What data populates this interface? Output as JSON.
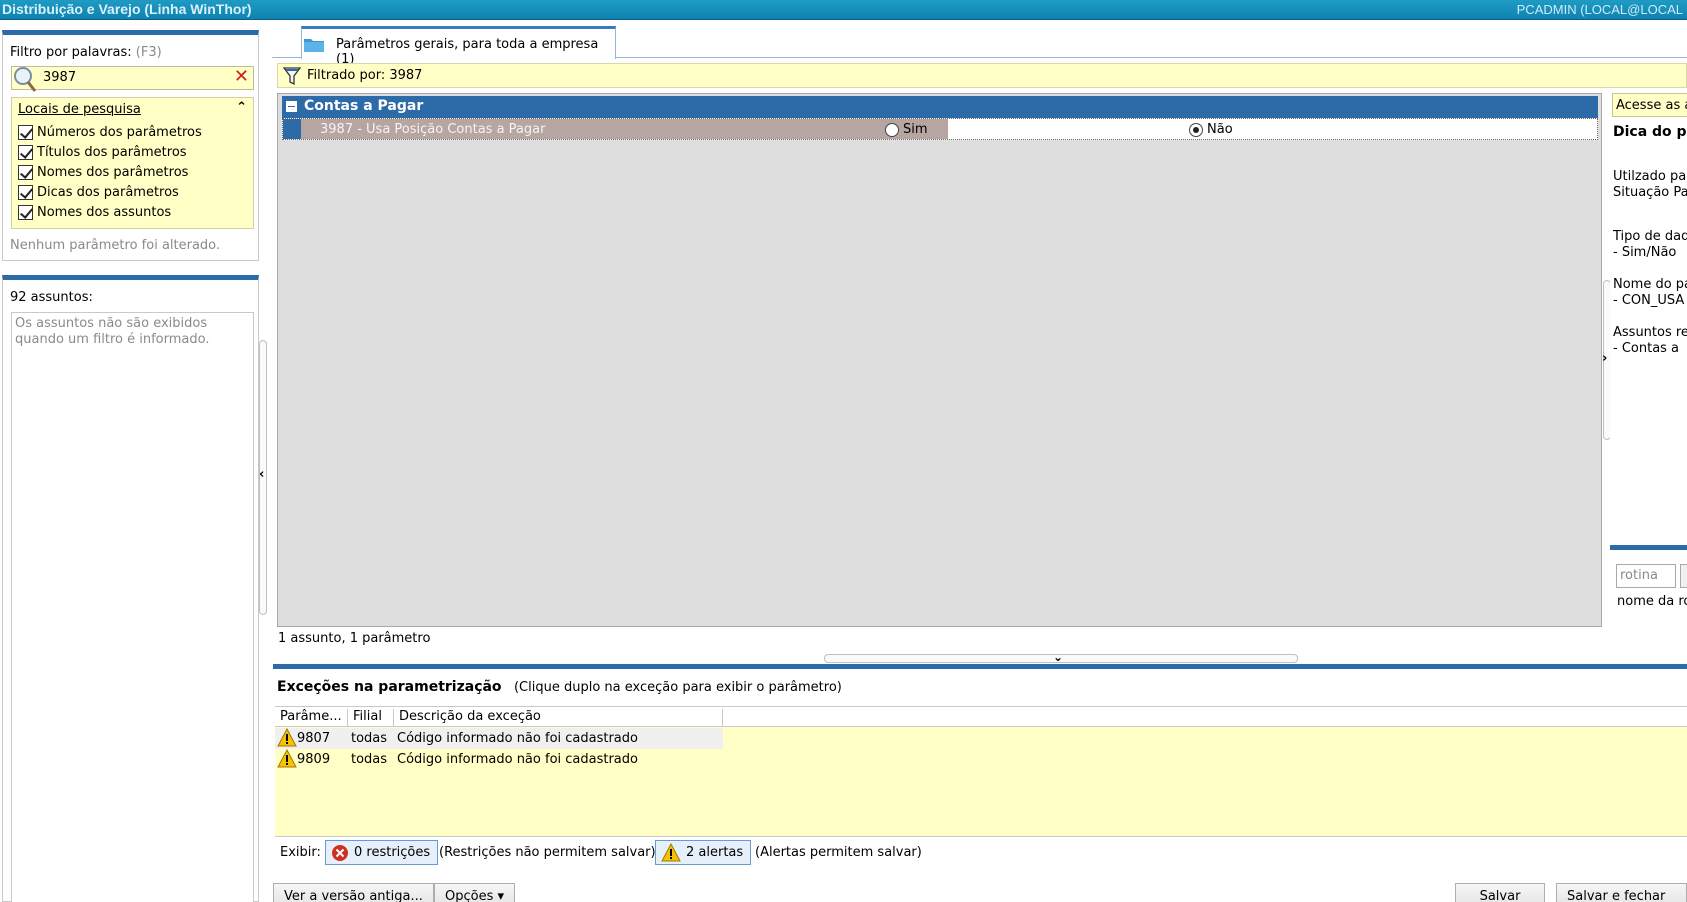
{
  "titlebar": {
    "app": "Distribuição e Varejo (Linha WinThor)",
    "user": "PCADMIN (LOCAL@LOCAL"
  },
  "filter": {
    "label": "Filtro por palavras:",
    "shortcut": "(F3)",
    "value": "3987",
    "locais_title": "Locais de pesquisa",
    "options": [
      "Números dos parâmetros",
      "Títulos dos parâmetros",
      "Nomes dos parâmetros",
      "Dicas dos parâmetros",
      "Nomes dos assuntos"
    ],
    "status": "Nenhum parâmetro foi alterado."
  },
  "assuntos": {
    "title": "92 assuntos:",
    "message": "Os assuntos não são exibidos quando um filtro é informado."
  },
  "tab": {
    "label": "Parâmetros gerais, para toda a empresa  (1)"
  },
  "filtered": {
    "label": "Filtrado por: 3987"
  },
  "group": {
    "label": "Contas a Pagar"
  },
  "param": {
    "label": "3987 - Usa Posição Contas a Pagar",
    "opt_yes": "Sim",
    "opt_no": "Não",
    "selected": "Não"
  },
  "count_line": "1 assunto, 1 parâmetro",
  "hint": {
    "acesse": "Acesse as al",
    "dica_title": "Dica do pa",
    "l1": "Utilzado par",
    "l2": "Situação Pag",
    "l3": "Tipo de dado",
    "l4": " - Sim/Não",
    "l5": "Nome do par",
    "l6": " - CON_USA",
    "l7": "Assuntos rel",
    "l8": " - Contas a",
    "rotina_placeholder": "rotina",
    "rotina_label": "nome da ro"
  },
  "exceptions": {
    "title": "Exceções na parametrização",
    "subtitle": "(Clique duplo na exceção para exibir o parâmetro)",
    "columns": [
      "Parâme...",
      "Filial",
      "Descrição da exceção"
    ],
    "rows": [
      {
        "param": "9807",
        "filial": "todas",
        "desc": "Código informado não foi cadastrado"
      },
      {
        "param": "9809",
        "filial": "todas",
        "desc": "Código informado não foi cadastrado"
      }
    ]
  },
  "show": {
    "label": "Exibir:",
    "restricoes": "0 restrições",
    "restricoes_note": "(Restrições não permitem salvar)",
    "alertas": "2 alertas",
    "alertas_note": "(Alertas permitem salvar)"
  },
  "buttons": {
    "old_version": "Ver a versão antiga...",
    "options": "Opções ▾",
    "save": "Salvar",
    "save_close": "Salvar e fechar"
  },
  "colors": {
    "accent": "#2c6aa8",
    "highlight": "#ffffc6",
    "selected_row": "#b7a5a2"
  }
}
